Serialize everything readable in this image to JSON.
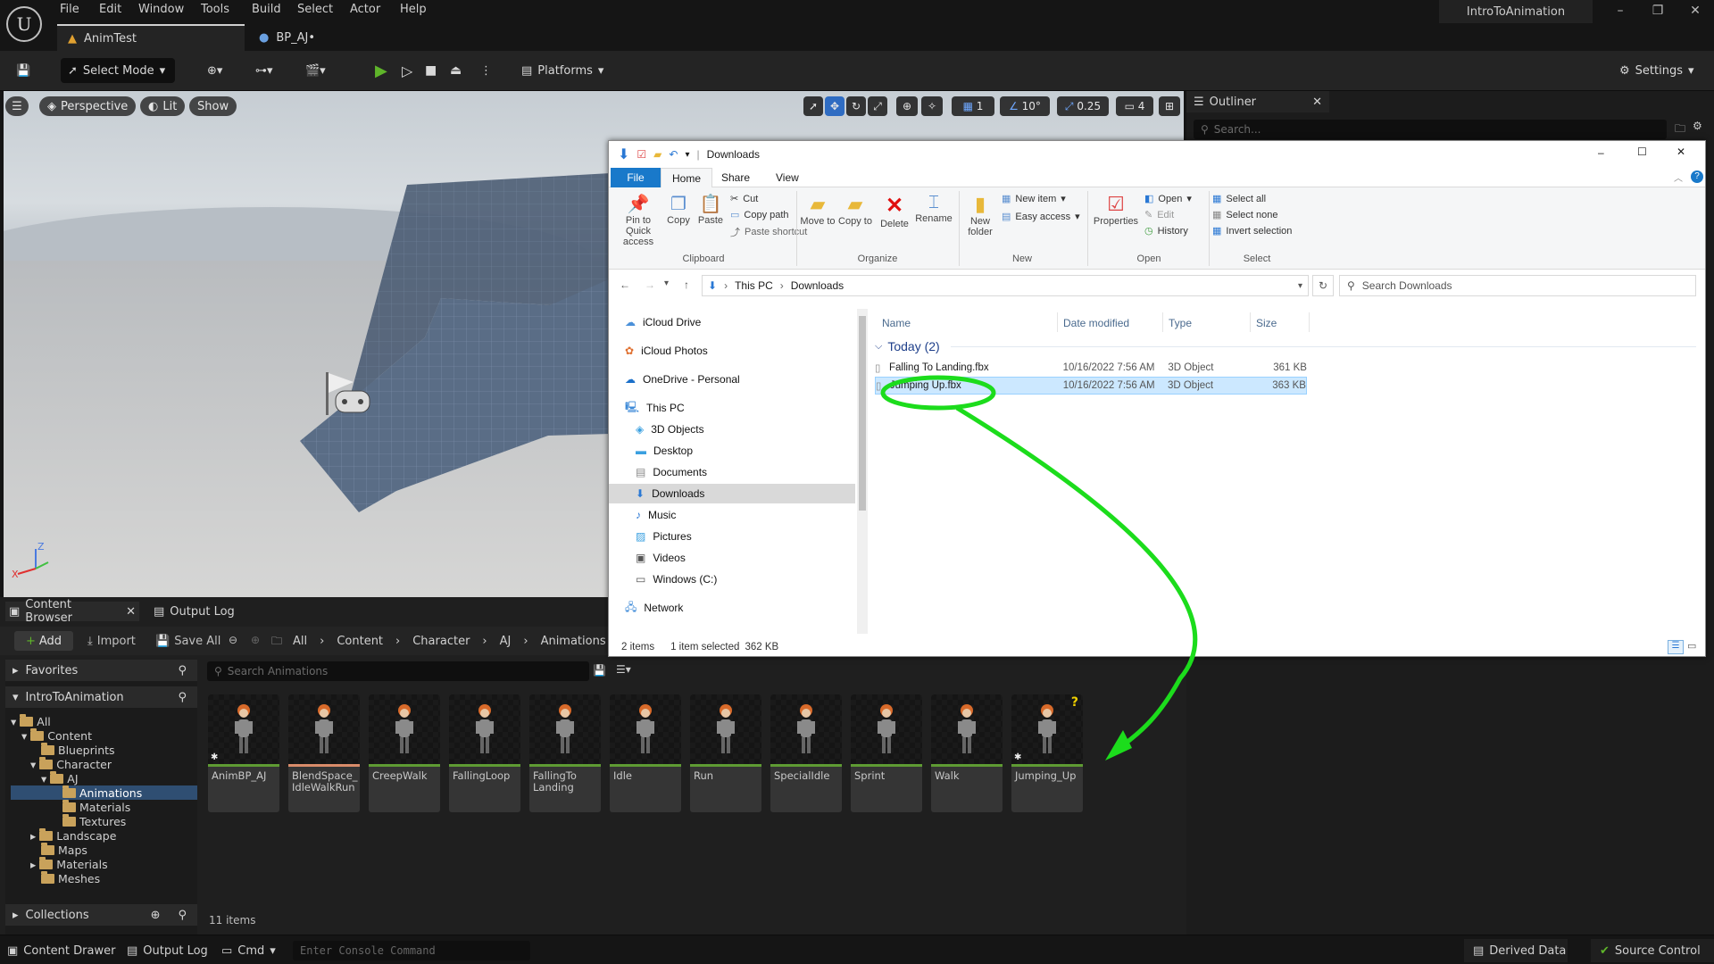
{
  "menu": {
    "items": [
      "File",
      "Edit",
      "Window",
      "Tools",
      "Build",
      "Select",
      "Actor",
      "Help"
    ],
    "project_name": "IntroToAnimation"
  },
  "doc_tabs": [
    {
      "label": "AnimTest"
    },
    {
      "label": "BP_AJ•"
    }
  ],
  "toolbar": {
    "select_mode": "Select Mode",
    "platforms": "Platforms",
    "settings": "Settings"
  },
  "viewport": {
    "perspective": "Perspective",
    "lit": "Lit",
    "show": "Show",
    "grid_value": "1",
    "angle_value": "10°",
    "scale_value": "0.25",
    "camera_speed": "4"
  },
  "outliner": {
    "title": "Outliner",
    "search_placeholder": "Search..."
  },
  "explorer": {
    "title": "Downloads",
    "ribbon_tabs": [
      "File",
      "Home",
      "Share",
      "View"
    ],
    "clipboard": {
      "pin": "Pin to Quick access",
      "copy": "Copy",
      "paste": "Paste",
      "cut": "Cut",
      "copy_path": "Copy path",
      "paste_shortcut": "Paste shortcut",
      "group": "Clipboard"
    },
    "organize": {
      "move_to": "Move to",
      "copy_to": "Copy to",
      "delete": "Delete",
      "rename": "Rename",
      "group": "Organize"
    },
    "new": {
      "new_folder": "New folder",
      "new_item": "New item",
      "easy_access": "Easy access",
      "group": "New"
    },
    "open": {
      "properties": "Properties",
      "open": "Open",
      "edit": "Edit",
      "history": "History",
      "group": "Open"
    },
    "select": {
      "select_all": "Select all",
      "select_none": "Select none",
      "invert": "Invert selection",
      "group": "Select"
    },
    "breadcrumb": [
      "This PC",
      "Downloads"
    ],
    "search_placeholder": "Search Downloads",
    "nav": [
      "iCloud Drive",
      "iCloud Photos",
      "OneDrive - Personal",
      "This PC",
      "3D Objects",
      "Desktop",
      "Documents",
      "Downloads",
      "Music",
      "Pictures",
      "Videos",
      "Windows (C:)",
      "Network"
    ],
    "columns": [
      "Name",
      "Date modified",
      "Type",
      "Size"
    ],
    "group_header": "Today (2)",
    "files": [
      {
        "name": "Falling To Landing.fbx",
        "date": "10/16/2022 7:56 AM",
        "type": "3D Object",
        "size": "361 KB"
      },
      {
        "name": "Jumping Up.fbx",
        "date": "10/16/2022 7:56 AM",
        "type": "3D Object",
        "size": "363 KB"
      }
    ],
    "status": {
      "items": "2 items",
      "selected": "1 item selected",
      "size": "362 KB"
    }
  },
  "content_browser": {
    "tab_label": "Content Browser",
    "output_log_tab": "Output Log",
    "add": "Add",
    "import": "Import",
    "save_all": "Save All",
    "path": [
      "All",
      "Content",
      "Character",
      "AJ",
      "Animations"
    ],
    "favorites": "Favorites",
    "project": "IntroToAnimation",
    "tree": [
      "All",
      "Content",
      "Blueprints",
      "Character",
      "AJ",
      "Animations",
      "Materials",
      "Textures",
      "Landscape",
      "Maps",
      "Materials",
      "Meshes"
    ],
    "collections": "Collections",
    "search_placeholder": "Search Animations",
    "item_count": "11 items",
    "assets": [
      {
        "name": "AnimBP_AJ",
        "bar": "#5e9b33"
      },
      {
        "name": "BlendSpace_ IdleWalkRun",
        "bar": "#d98c6a"
      },
      {
        "name": "CreepWalk",
        "bar": "#5e9b33"
      },
      {
        "name": "FallingLoop",
        "bar": "#5e9b33"
      },
      {
        "name": "FallingTo Landing",
        "bar": "#5e9b33"
      },
      {
        "name": "Idle",
        "bar": "#5e9b33"
      },
      {
        "name": "Run",
        "bar": "#5e9b33"
      },
      {
        "name": "SpecialIdle",
        "bar": "#5e9b33"
      },
      {
        "name": "Sprint",
        "bar": "#5e9b33"
      },
      {
        "name": "Walk",
        "bar": "#5e9b33"
      },
      {
        "name": "Jumping_Up",
        "bar": "#5e9b33"
      }
    ]
  },
  "statusbar": {
    "content_drawer": "Content Drawer",
    "output_log": "Output Log",
    "cmd": "Cmd",
    "console_placeholder": "Enter Console Command",
    "derived_data": "Derived Data",
    "source_control": "Source Control"
  },
  "colors": {
    "highlight_green": "#1cdc1c",
    "play_green": "#5fb52a",
    "selection_blue": "#cce8ff",
    "ue_selection": "#2f4e72"
  }
}
